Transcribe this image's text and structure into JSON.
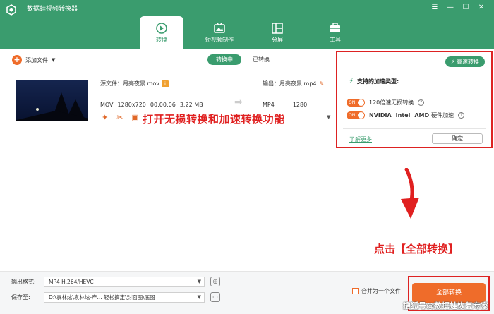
{
  "app": {
    "title": "数据蛙视频转换器"
  },
  "window_controls": [
    "☰",
    "—",
    "☐",
    "✕"
  ],
  "tabs": [
    {
      "label": "转换",
      "icon": "convert-icon",
      "active": true
    },
    {
      "label": "短视频制作",
      "icon": "short-video-icon",
      "active": false
    },
    {
      "label": "分屏",
      "icon": "split-screen-icon",
      "active": false
    },
    {
      "label": "工具",
      "icon": "toolbox-icon",
      "active": false
    }
  ],
  "toolbar": {
    "add_file": "添加文件",
    "converting": "转换中",
    "converted": "已转换"
  },
  "file": {
    "source_label": "源文件：月亮夜景.mov",
    "format": "MOV",
    "resolution": "1280x720",
    "duration": "00:00:06",
    "size": "3.22 MB",
    "output_label": "输出：月亮夜景.mp4",
    "out_format": "MP4",
    "out_resolution": "1280"
  },
  "annotation_1": "打开无损转换和加速转换功能",
  "annotation_2": "点击【全部转换】",
  "popup": {
    "high_speed": "高速转换",
    "title": "支持的加速类型:",
    "toggle_on": "ON",
    "option1": "120倍速无损转换",
    "option2_a": "NVIDIA",
    "option2_b": "Intel",
    "option2_c": "AMD",
    "option2_d": "硬件加速",
    "learn_more": "了解更多",
    "confirm": "确定"
  },
  "bottom": {
    "output_format_label": "输出格式:",
    "output_format_value": "MP4 H.264/HEVC",
    "save_to_label": "保存至:",
    "save_to_value": "D:\\袁林炫\\袁林炫-产... 轻松搞定\\封面图\\底图",
    "merge_label": "合并为一个文件",
    "convert_all": "全部转换"
  },
  "watermark": "搜狐号@数据蛙恢复专家",
  "colors": {
    "brand_green": "#3a9c6e",
    "accent_orange": "#ef6c2a",
    "annotation_red": "#e02020"
  }
}
